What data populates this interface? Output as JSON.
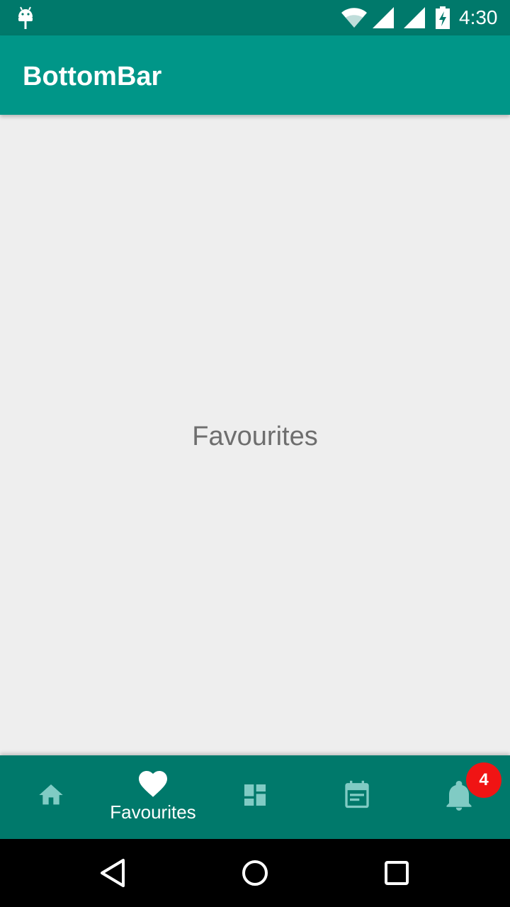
{
  "status_bar": {
    "time": "4:30",
    "icons": [
      "android-icon",
      "wifi-icon",
      "signal-icon",
      "signal-icon",
      "battery-charging-icon"
    ]
  },
  "app_bar": {
    "title": "BottomBar"
  },
  "content": {
    "label": "Favourites"
  },
  "bottom_bar": {
    "tabs": [
      {
        "id": "home",
        "icon": "home-icon",
        "label": "",
        "selected": false
      },
      {
        "id": "favourites",
        "icon": "heart-icon",
        "label": "Favourites",
        "selected": true
      },
      {
        "id": "dashboard",
        "icon": "dashboard-icon",
        "label": "",
        "selected": false
      },
      {
        "id": "calendar",
        "icon": "calendar-icon",
        "label": "",
        "selected": false
      },
      {
        "id": "notifications",
        "icon": "bell-icon",
        "label": "",
        "selected": false,
        "badge": "4"
      }
    ]
  },
  "nav_bar": {
    "icons": [
      "back-icon",
      "home-circle-icon",
      "recents-icon"
    ]
  },
  "colors": {
    "status_bar": "#00796b",
    "app_bar": "#009688",
    "bottom_bar": "#00796b",
    "background": "#eeeeee",
    "inactive_icon": "#80cbc4",
    "badge": "#f01414",
    "content_text": "#6e6e6e"
  }
}
